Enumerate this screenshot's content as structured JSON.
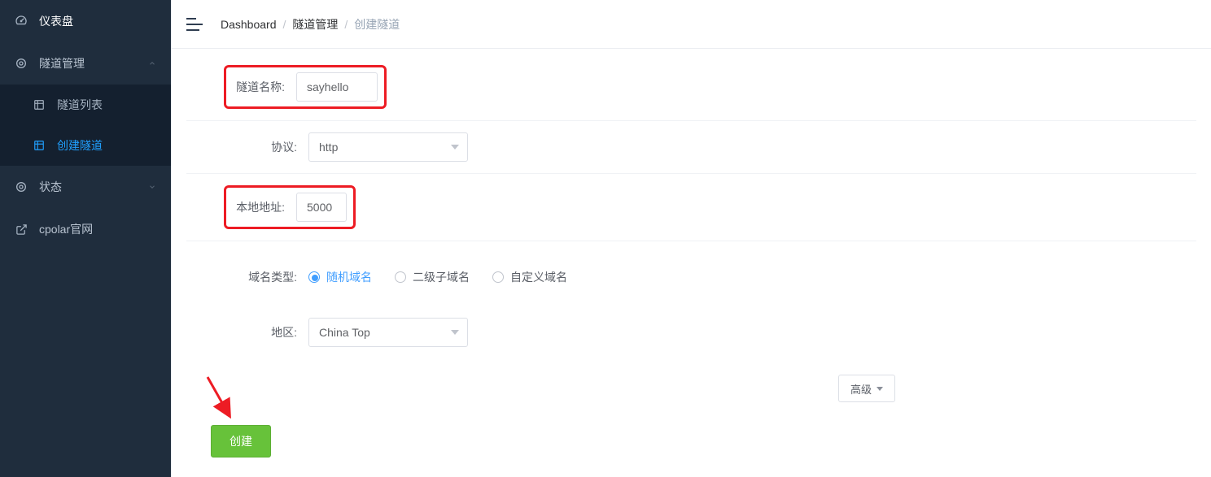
{
  "sidebar": {
    "dashboard": "仪表盘",
    "tunnel_mgmt": "隧道管理",
    "tunnel_list": "隧道列表",
    "tunnel_create": "创建隧道",
    "status": "状态",
    "cpolar_site": "cpolar官网"
  },
  "breadcrumb": {
    "a": "Dashboard",
    "b": "隧道管理",
    "c": "创建隧道"
  },
  "form": {
    "name_label": "隧道名称:",
    "name_value": "sayhello",
    "protocol_label": "协议:",
    "protocol_value": "http",
    "local_addr_label": "本地地址:",
    "local_addr_value": "5000",
    "domain_type_label": "域名类型:",
    "domain_options": {
      "random": "随机域名",
      "sub": "二级子域名",
      "custom": "自定义域名"
    },
    "region_label": "地区:",
    "region_value": "China Top",
    "advanced_label": "高级",
    "submit_label": "创建"
  },
  "colors": {
    "sidebar_bg": "#1f2d3d",
    "sidebar_sub_bg": "#14202f",
    "accent_blue": "#409eff",
    "accent_green": "#67c23a",
    "annotation_red": "#ed1c24"
  }
}
